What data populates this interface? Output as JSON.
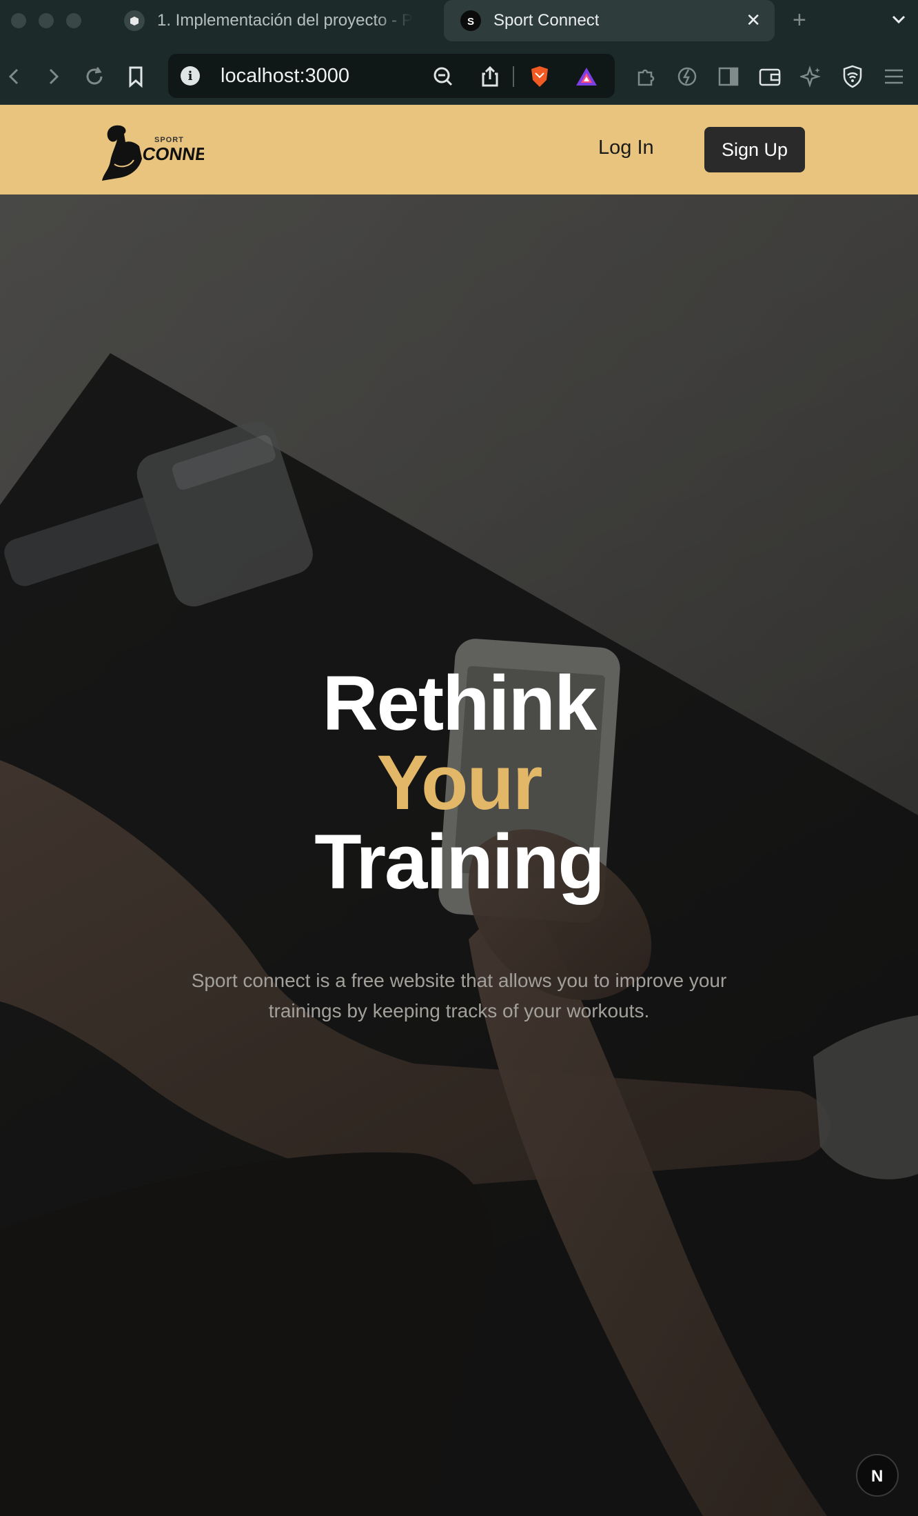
{
  "browser": {
    "tabs": [
      {
        "title": "1. Implementación del proyecto - P",
        "active": false,
        "icon": "notion-like-icon"
      },
      {
        "title": "Sport Connect",
        "active": true,
        "icon": "sport-connect-favicon"
      }
    ],
    "url": "localhost:3000"
  },
  "site": {
    "logo_top": "SPORT",
    "logo_bottom": "CONNECT",
    "nav": {
      "login_label": "Log In",
      "signup_label": "Sign Up"
    }
  },
  "hero": {
    "title_line1": "Rethink",
    "title_line2": "Your",
    "title_line3": "Training",
    "subtitle": "Sport connect is a free website that allows you to improve your trainings by keeping tracks of your workouts."
  },
  "badge": {
    "letter": "N"
  },
  "colors": {
    "header_bg": "#e9c47e",
    "accent": "#e2b868",
    "button_dark": "#2a2a2a",
    "chrome_bg": "#1d2a2a"
  }
}
